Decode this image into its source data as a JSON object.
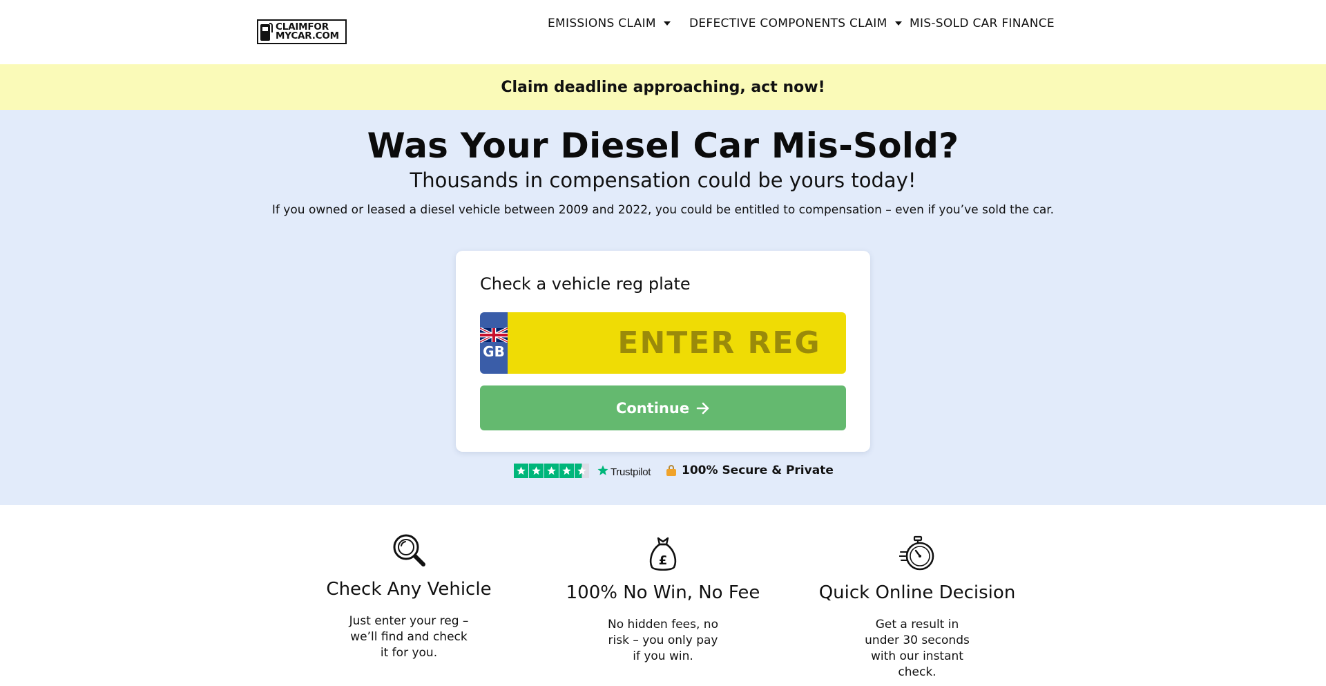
{
  "logo": {
    "line1": "CLAIMFOR",
    "line2": "MYCAR.COM"
  },
  "nav": {
    "items": [
      {
        "label": "EMISSIONS CLAIM",
        "has_dropdown": true
      },
      {
        "label": "DEFECTIVE COMPONENTS CLAIM",
        "has_dropdown": true
      },
      {
        "label": "MIS-SOLD CAR FINANCE",
        "has_dropdown": false
      }
    ]
  },
  "banner": {
    "text": "Claim deadline approaching, act now!"
  },
  "hero": {
    "title": "Was Your Diesel Car Mis-Sold?",
    "subtitle": "Thousands in compensation could be yours today!",
    "lead": "If you owned or leased a diesel vehicle between 2009 and 2022, you could be entitled to compensation – even if you’ve sold the car."
  },
  "reg_card": {
    "title": "Check a vehicle reg plate",
    "country_code": "GB",
    "input_placeholder": "ENTER REG",
    "input_value": "",
    "continue_label": "Continue"
  },
  "trust": {
    "trustpilot_label": "Trustpilot",
    "rating_stars": 4.5,
    "secure_label": "100% Secure & Private"
  },
  "features": [
    {
      "icon": "magnifier-icon",
      "title": "Check Any Vehicle",
      "description": "Just enter your reg – we’ll find and check it for you."
    },
    {
      "icon": "money-bag-icon",
      "title": "100% No Win, No Fee",
      "description": "No hidden fees, no risk – you only pay if you win."
    },
    {
      "icon": "stopwatch-icon",
      "title": "Quick Online Decision",
      "description": "Get a result in under 30 seconds with our instant check."
    }
  ],
  "colors": {
    "banner_bg": "#fafab8",
    "hero_bg": "#e2ebfa",
    "plate_yellow": "#efdc05",
    "plate_blue": "#3a5da8",
    "button_green": "#64b96f",
    "trustpilot_green": "#00b67a"
  }
}
